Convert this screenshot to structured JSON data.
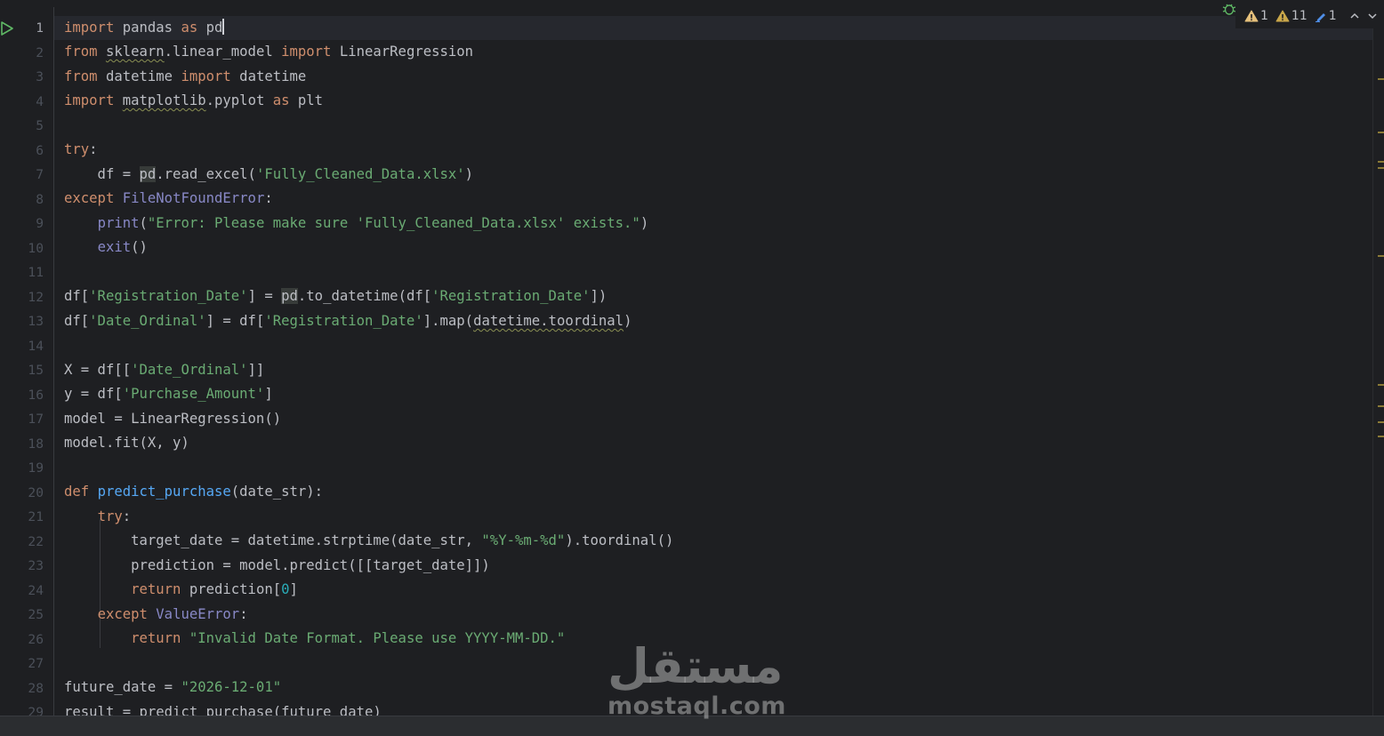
{
  "editor": {
    "current_line": 1,
    "lines": [
      {
        "n": "1"
      },
      {
        "n": "2"
      },
      {
        "n": "3"
      },
      {
        "n": "4"
      },
      {
        "n": "5"
      },
      {
        "n": "6"
      },
      {
        "n": "7"
      },
      {
        "n": "8"
      },
      {
        "n": "9"
      },
      {
        "n": "10"
      },
      {
        "n": "11"
      },
      {
        "n": "12"
      },
      {
        "n": "13"
      },
      {
        "n": "14"
      },
      {
        "n": "15"
      },
      {
        "n": "16"
      },
      {
        "n": "17"
      },
      {
        "n": "18"
      },
      {
        "n": "19"
      },
      {
        "n": "20"
      },
      {
        "n": "21"
      },
      {
        "n": "22"
      },
      {
        "n": "23"
      },
      {
        "n": "24"
      },
      {
        "n": "25"
      },
      {
        "n": "26"
      },
      {
        "n": "27"
      },
      {
        "n": "28"
      },
      {
        "n": "29"
      }
    ],
    "code": {
      "l1": [
        "import",
        " pandas ",
        "as",
        " pd"
      ],
      "l2": [
        "from",
        " ",
        "sklearn",
        ".linear_model ",
        "import",
        " LinearRegression"
      ],
      "l3": [
        "from",
        " datetime ",
        "import",
        " datetime"
      ],
      "l4": [
        "import",
        " ",
        "matplotlib",
        ".pyplot ",
        "as",
        " plt"
      ],
      "l6": [
        "try",
        ":"
      ],
      "l7": [
        "    df = ",
        "pd",
        ".read_excel(",
        "'Fully_Cleaned_Data.xlsx'",
        ")"
      ],
      "l8": [
        "except",
        " ",
        "FileNotFoundError",
        ":"
      ],
      "l9": [
        "    ",
        "print",
        "(",
        "\"Error: Please make sure 'Fully_Cleaned_Data.xlsx' exists.\"",
        ")"
      ],
      "l10": [
        "    ",
        "exit",
        "()"
      ],
      "l12": [
        "df[",
        "'Registration_Date'",
        "] = ",
        "pd",
        ".to_datetime(df[",
        "'Registration_Date'",
        "])"
      ],
      "l13": [
        "df[",
        "'Date_Ordinal'",
        "] = df[",
        "'Registration_Date'",
        "].map(",
        "datetime.toordinal",
        ")"
      ],
      "l15": [
        "X = df[[",
        "'Date_Ordinal'",
        "]]"
      ],
      "l16": [
        "y = df[",
        "'Purchase_Amount'",
        "]"
      ],
      "l17": [
        "model = LinearRegression()"
      ],
      "l18": [
        "model.fit(X, y)"
      ],
      "l20": [
        "def",
        " ",
        "predict_purchase",
        "(date_str):"
      ],
      "l21": [
        "    ",
        "try",
        ":"
      ],
      "l22": [
        "        target_date = datetime.strptime(date_str, ",
        "\"%Y-%m-%d\"",
        ").toordinal()"
      ],
      "l23": [
        "        prediction = model.predict([[target_date]])"
      ],
      "l24": [
        "        ",
        "return",
        " prediction[",
        "0",
        "]"
      ],
      "l25": [
        "    ",
        "except",
        " ",
        "ValueError",
        ":"
      ],
      "l26": [
        "        ",
        "return",
        " ",
        "\"Invalid Date Format. Please use YYYY-MM-DD.\""
      ],
      "l28": [
        "future_date = ",
        "\"2026-12-01\""
      ],
      "l29": [
        "result = predict_purchase(future_date)"
      ]
    }
  },
  "inspections": {
    "errors": "1",
    "warnings": "11",
    "typos": "1"
  },
  "watermark": {
    "arabic": "مستقل",
    "latin": "mostaql.com"
  },
  "colors": {
    "background": "#1e1f22",
    "keyword": "#cf8e6d",
    "string": "#6aab73",
    "number": "#2aacb8",
    "function": "#56a8f5",
    "builtin": "#8888c6",
    "text": "#bcbec4"
  }
}
